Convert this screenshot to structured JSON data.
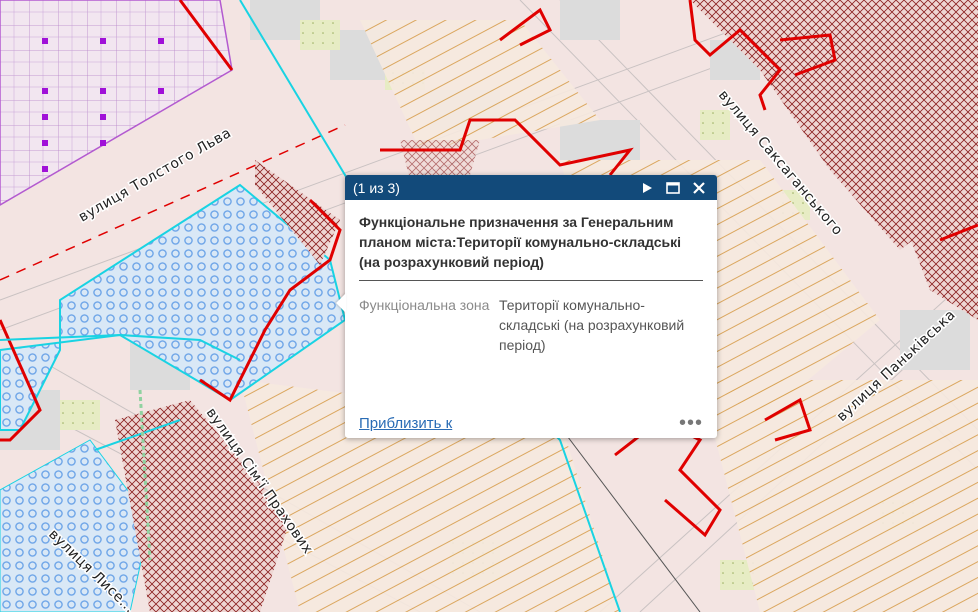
{
  "map": {
    "streets": {
      "tolstoho": "вулиця Толстого Льва",
      "saksahanskoho": "вулиця Саксаганського",
      "pankivska": "вулиця Паньківська",
      "sim_prakhovykh": "вулиця Сім'ї Прахових",
      "lysenka": "вулиця Лисе..."
    },
    "colors": {
      "background": "#f3e4e2",
      "boundary_red": "#e00000",
      "boundary_cyan": "#19d3e3",
      "zone_blue": "#6fa6e8",
      "zone_purple": "#b83bd6",
      "hatch_brown": "#8b2020",
      "hatch_orange": "#d8a050"
    }
  },
  "popup": {
    "counter": "(1 из 3)",
    "title": "Функціональне призначення за Генеральним планом міста:Території комунально-складські (на розрахунковий період)",
    "attribute": {
      "name": "Функціональна зона",
      "value": "Території комунально-складські (на розрахунковий період)"
    },
    "zoom_label": "Приблизить к",
    "more_label": "•••",
    "icons": [
      "play-icon",
      "maximize-icon",
      "close-icon"
    ],
    "header_color": "#124a7a"
  }
}
